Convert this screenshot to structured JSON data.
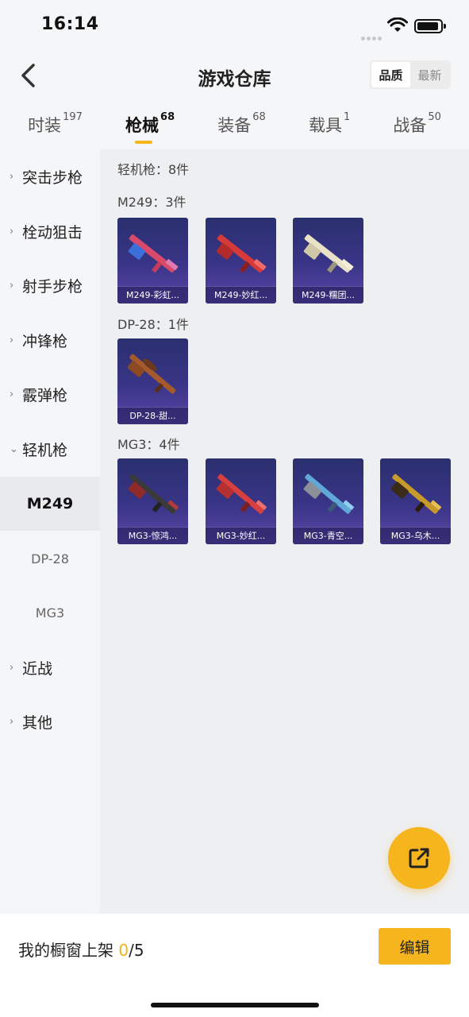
{
  "status": {
    "time": "16:14"
  },
  "header": {
    "title": "游戏仓库",
    "sort_options": [
      "品质",
      "最新"
    ]
  },
  "tabs": [
    {
      "label": "时装",
      "count": "197"
    },
    {
      "label": "枪械",
      "count": "68"
    },
    {
      "label": "装备",
      "count": "68"
    },
    {
      "label": "载具",
      "count": "1"
    },
    {
      "label": "战备",
      "count": "50"
    }
  ],
  "sidebar": {
    "categories": [
      "突击步枪",
      "栓动狙击",
      "射手步枪",
      "冲锋枪",
      "霰弹枪",
      "轻机枪"
    ],
    "subitems": [
      "M249",
      "DP-28",
      "MG3"
    ],
    "more": [
      "近战",
      "其他"
    ]
  },
  "content": {
    "summary": "轻机枪：8件",
    "groups": [
      {
        "label": "M249：3件",
        "items": [
          "M249-彩虹...",
          "M249-妙红...",
          "M249-糯团..."
        ]
      },
      {
        "label": "DP-28：1件",
        "items": [
          "DP-28-甜..."
        ]
      },
      {
        "label": "MG3：4件",
        "items": [
          "MG3-惊鸿...",
          "MG3-妙红...",
          "MG3-青空...",
          "MG3-乌木..."
        ]
      }
    ]
  },
  "bottom": {
    "showcase_label": "我的橱窗上架",
    "current": "0",
    "max": "/5",
    "edit": "编辑"
  },
  "colors": {
    "accent": "#f6b51d",
    "card_top": "#2a2f6e",
    "card_bottom": "#5b46a8"
  },
  "icons": [
    "back-chevron-icon",
    "wifi-icon",
    "battery-icon",
    "share-external-icon"
  ]
}
